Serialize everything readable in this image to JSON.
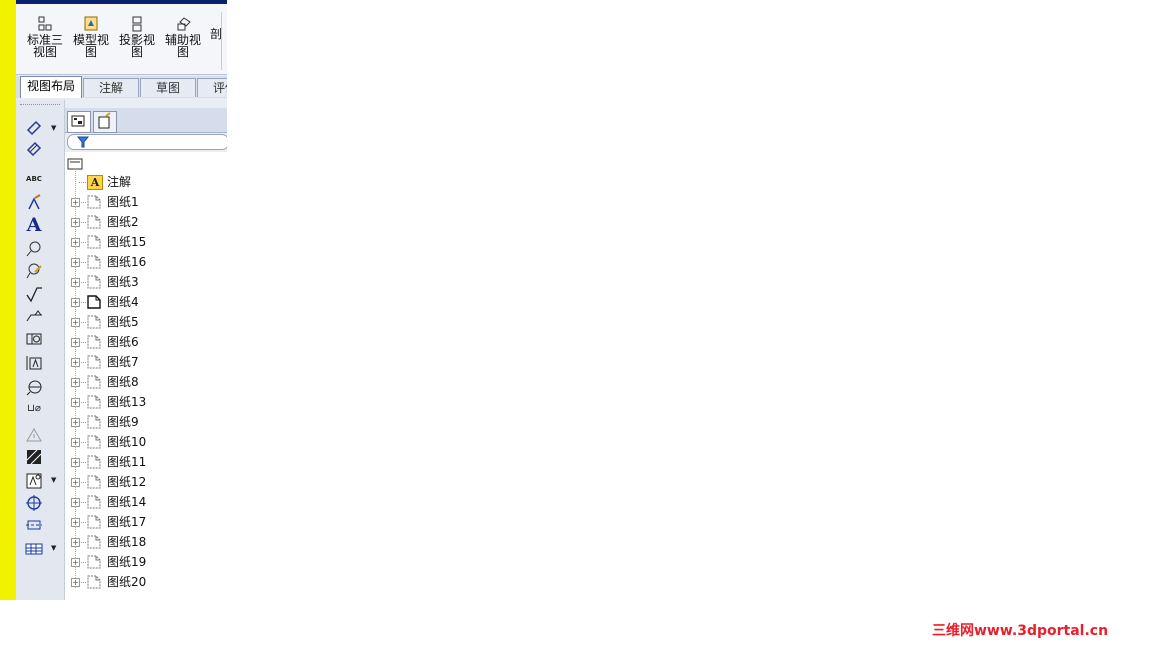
{
  "ribbon": {
    "buttons": [
      {
        "line1": "标准三",
        "line2": "视图",
        "icon": "standard-3view-icon"
      },
      {
        "line1": "模型视",
        "line2": "图",
        "icon": "model-view-icon"
      },
      {
        "line1": "投影视",
        "line2": "图",
        "icon": "projected-view-icon"
      },
      {
        "line1": "辅助视",
        "line2": "图",
        "icon": "auxiliary-view-icon"
      },
      {
        "line1": "剖",
        "line2": "",
        "icon": "section-view-icon"
      }
    ]
  },
  "tabs": [
    {
      "label": "视图布局",
      "active": true
    },
    {
      "label": "注解",
      "active": false
    },
    {
      "label": "草图",
      "active": false
    },
    {
      "label": "评估",
      "active": false
    }
  ],
  "toolbar": {
    "icons": [
      "smart-dimension-icon",
      "model-items-icon",
      "spell-check-icon",
      "format-painter-icon",
      "note-icon",
      "balloon-icon",
      "auto-balloon-icon",
      "surface-finish-icon",
      "weld-symbol-icon",
      "geometric-tolerance-icon",
      "datum-feature-icon",
      "datum-target-icon",
      "hole-callout-icon",
      "revision-symbol-icon",
      "area-hatch-icon",
      "blocks-icon",
      "center-mark-icon",
      "centerline-icon",
      "tables-icon"
    ],
    "glyph_abc": "ABC",
    "glyph_a": "A",
    "glyph_hole": "⊔⌀"
  },
  "tree": {
    "annotations_label": "注解",
    "annotations_glyph": "A",
    "sheets": [
      "图纸1",
      "图纸2",
      "图纸15",
      "图纸16",
      "图纸3",
      "图纸4",
      "图纸5",
      "图纸6",
      "图纸7",
      "图纸8",
      "图纸13",
      "图纸9",
      "图纸10",
      "图纸11",
      "图纸12",
      "图纸14",
      "图纸17",
      "图纸18",
      "图纸19",
      "图纸20"
    ],
    "active_sheet": "图纸4"
  },
  "watermark": "三维网www.3dportal.cn",
  "colors": {
    "yellow_bar": "#f2f200",
    "title_bar": "#0a1f6e",
    "watermark": "#e8202b"
  }
}
